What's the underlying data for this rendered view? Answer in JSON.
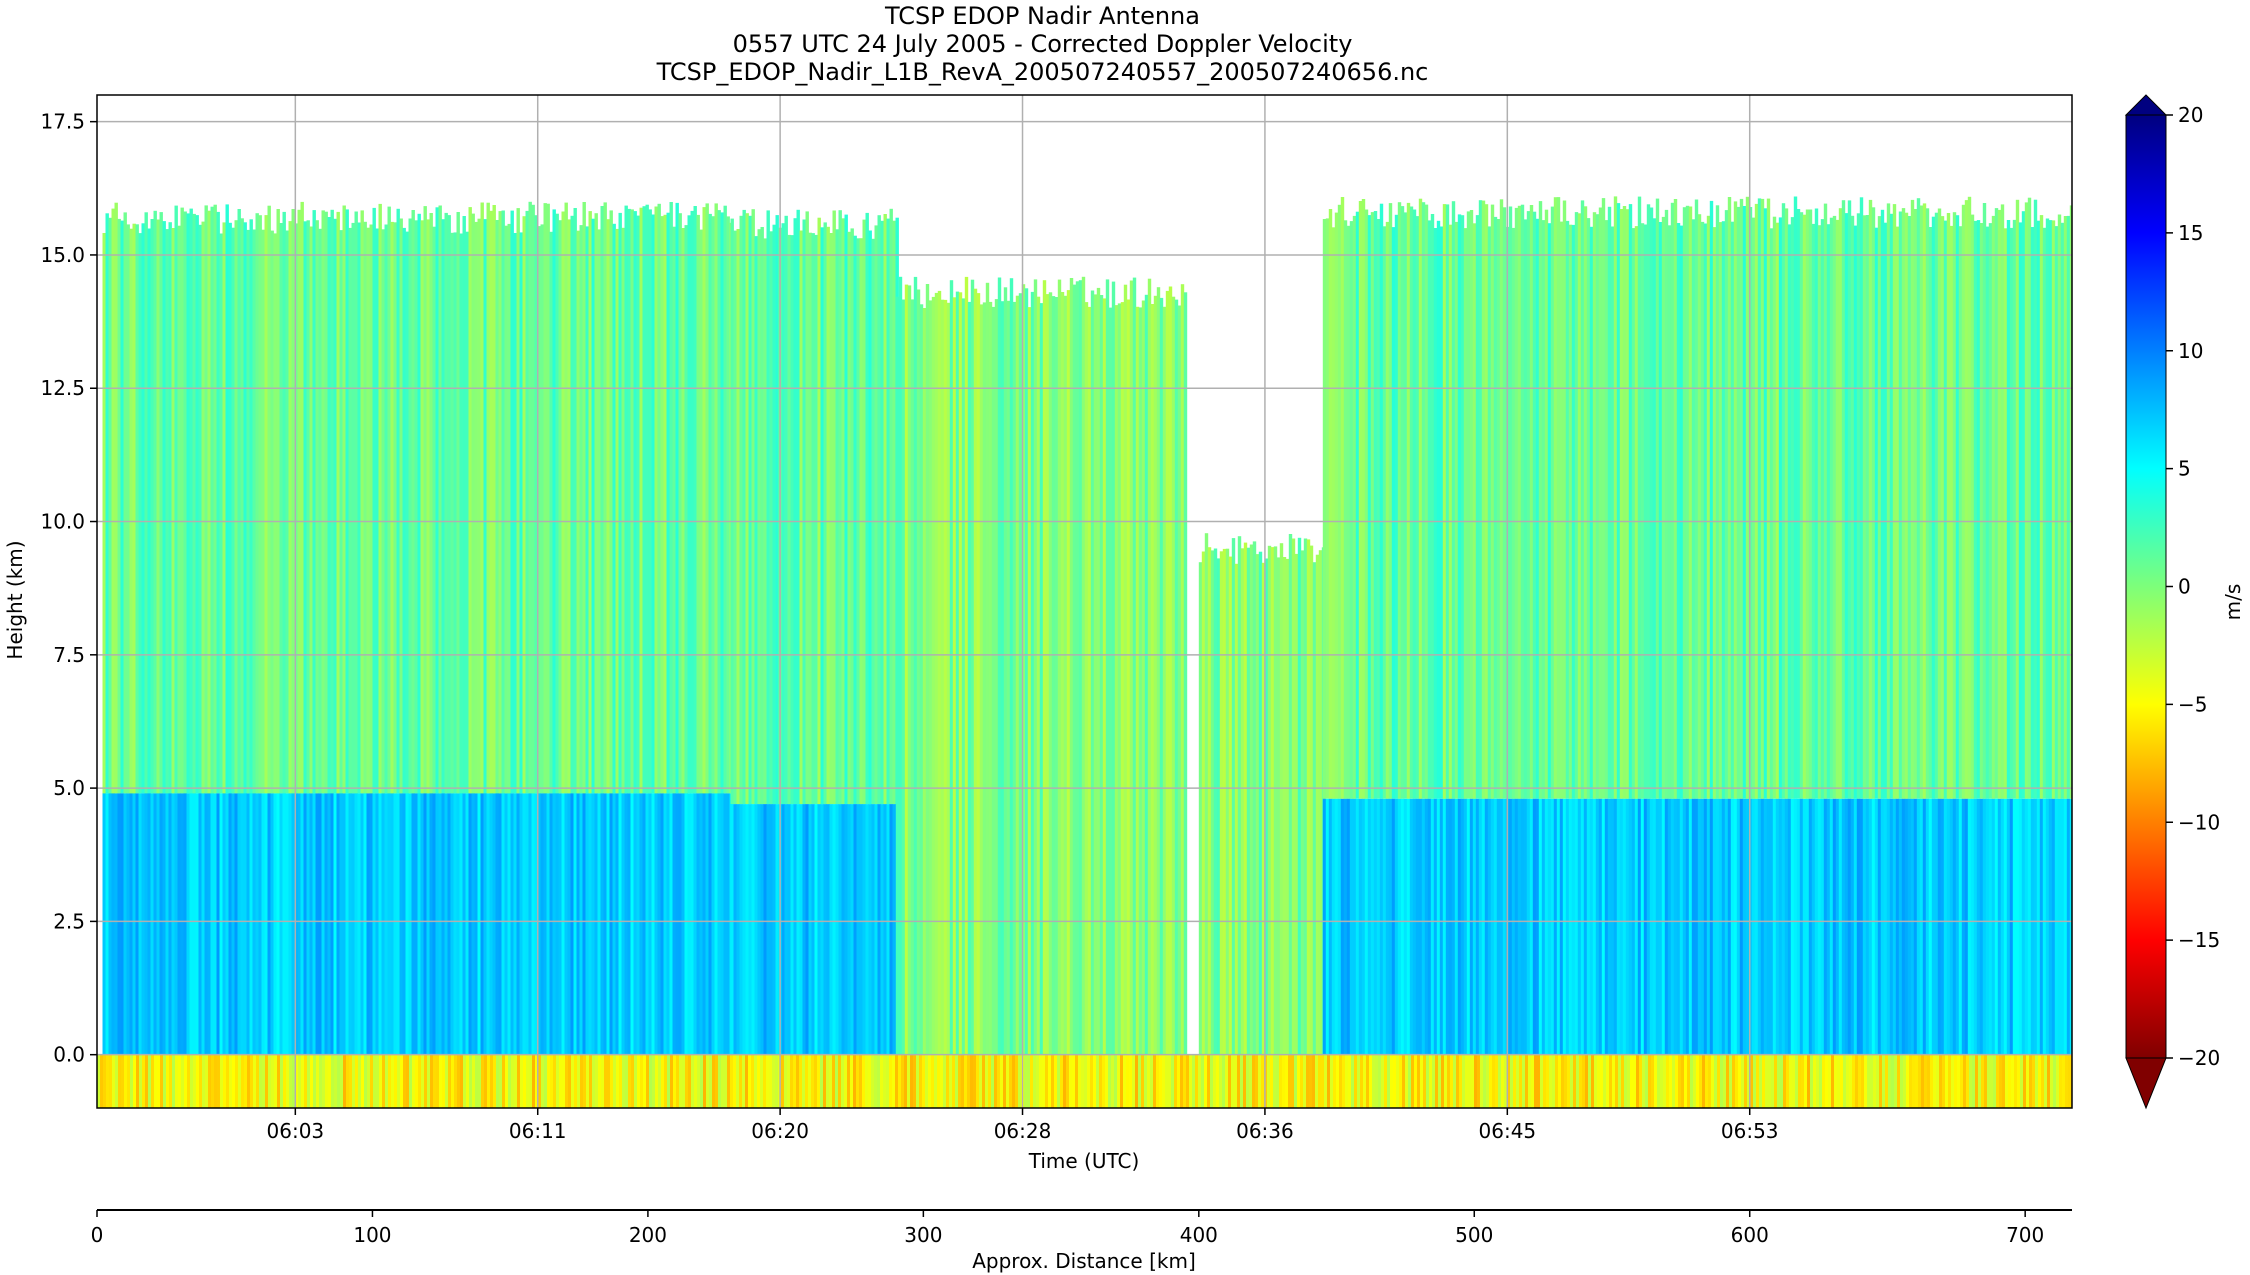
{
  "chart_data": {
    "type": "heatmap",
    "title_lines": [
      "TCSP EDOP Nadir Antenna",
      "0557 UTC 24 July 2005 - Corrected Doppler Velocity",
      "TCSP_EDOP_Nadir_L1B_RevA_200507240557_200507240656.nc"
    ],
    "xlabel": "Time (UTC)",
    "ylabel": "Height (km)",
    "x_ticks": [
      "06:03",
      "06:11",
      "06:20",
      "06:28",
      "06:36",
      "06:45",
      "06:53"
    ],
    "x_tick_positions_km": [
      72,
      160,
      248,
      336,
      424,
      512,
      600
    ],
    "y_ticks": [
      0.0,
      2.5,
      5.0,
      7.5,
      10.0,
      12.5,
      15.0,
      17.5
    ],
    "y_tick_labels": [
      "0.0",
      "2.5",
      "5.0",
      "7.5",
      "10.0",
      "12.5",
      "15.0",
      "17.5"
    ],
    "ylim": [
      -1.0,
      18.0
    ],
    "grid": true,
    "secondary_x": {
      "label": "Approx. Distance [km]",
      "ticks": [
        0,
        100,
        200,
        300,
        400,
        500,
        600,
        700
      ],
      "tick_labels": [
        "0",
        "100",
        "200",
        "300",
        "400",
        "500",
        "600",
        "700"
      ],
      "xlim": [
        0,
        717
      ]
    },
    "colorbar": {
      "label": "m/s",
      "vmin": -20,
      "vmax": 20,
      "ticks": [
        20,
        15,
        10,
        5,
        0,
        -5,
        -10,
        -15,
        -20
      ],
      "tick_labels": [
        "20",
        "15",
        "10",
        "5",
        "0",
        "−5",
        "−10",
        "−15",
        "−20"
      ],
      "colormap": "jet_r",
      "extend": "both"
    },
    "echo_segments": [
      {
        "x_start": 2,
        "x_end": 230,
        "echo_top_km": 15.7,
        "lower_layer_top_km": 4.9,
        "dominant_velocity_ms": 1
      },
      {
        "x_start": 230,
        "x_end": 290,
        "echo_top_km": 15.6,
        "lower_layer_top_km": 4.7,
        "dominant_velocity_ms": 1
      },
      {
        "x_start": 290,
        "x_end": 395,
        "echo_top_km": 14.3,
        "lower_layer_top_km": 0,
        "dominant_velocity_ms": 0
      },
      {
        "x_start": 400,
        "x_end": 445,
        "echo_top_km": 9.5,
        "lower_layer_top_km": 0,
        "dominant_velocity_ms": 0
      },
      {
        "x_start": 445,
        "x_end": 717,
        "echo_top_km": 15.8,
        "lower_layer_top_km": 4.8,
        "dominant_velocity_ms": 1
      }
    ],
    "surface_return": {
      "y_range_km": [
        -1.0,
        0.0
      ],
      "dominant_velocity_ms": -5
    }
  }
}
